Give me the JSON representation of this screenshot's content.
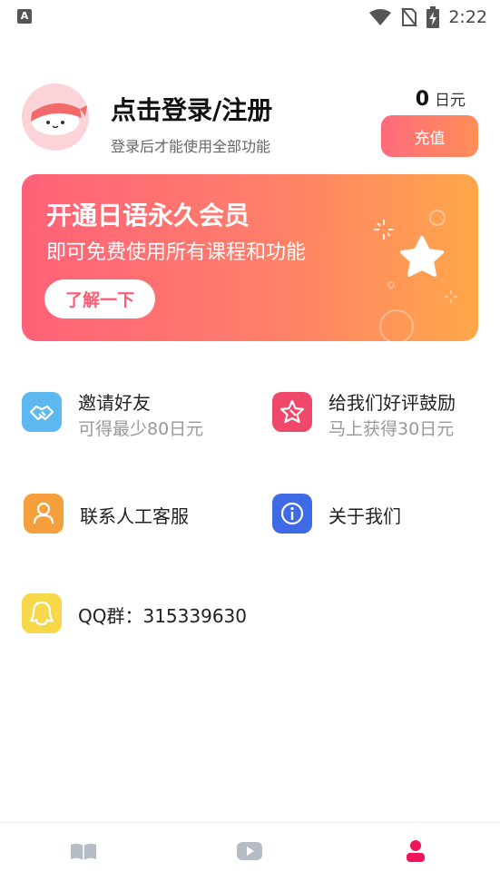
{
  "status_bar": {
    "time": "2:22",
    "app_badge": "A",
    "icons": [
      "wifi-icon",
      "no-sim-icon",
      "battery-charging-icon"
    ]
  },
  "profile": {
    "login_title": "点击登录/注册",
    "login_subtitle": "登录后才能使用全部功能",
    "balance_value": "0",
    "balance_unit": "日元",
    "recharge_label": "充值"
  },
  "vip_banner": {
    "title": "开通日语永久会员",
    "subtitle": "即可免费使用所有课程和功能",
    "button_label": "了解一下"
  },
  "menu": {
    "invite": {
      "title": "邀请好友",
      "subtitle": "可得最少80日元",
      "icon": "handshake-icon",
      "color": "#5cb8ef"
    },
    "rate": {
      "title": "给我们好评鼓励",
      "subtitle": "马上获得30日元",
      "icon": "star-icon",
      "color": "#f0486a"
    },
    "support": {
      "title": "联系人工客服",
      "icon": "person-icon",
      "color": "#f5a03c"
    },
    "about": {
      "title": "关于我们",
      "icon": "info-icon",
      "color": "#3f6ae6"
    },
    "qq": {
      "title": "QQ群：315339630",
      "icon": "qq-penguin-icon",
      "color": "#f6d84a"
    }
  },
  "tabbar": {
    "tabs": [
      {
        "name": "book-icon",
        "active": false
      },
      {
        "name": "video-play-icon",
        "active": false
      },
      {
        "name": "user-icon",
        "active": true
      }
    ],
    "active_color": "#f0145a",
    "inactive_color": "#b6bcc6"
  }
}
